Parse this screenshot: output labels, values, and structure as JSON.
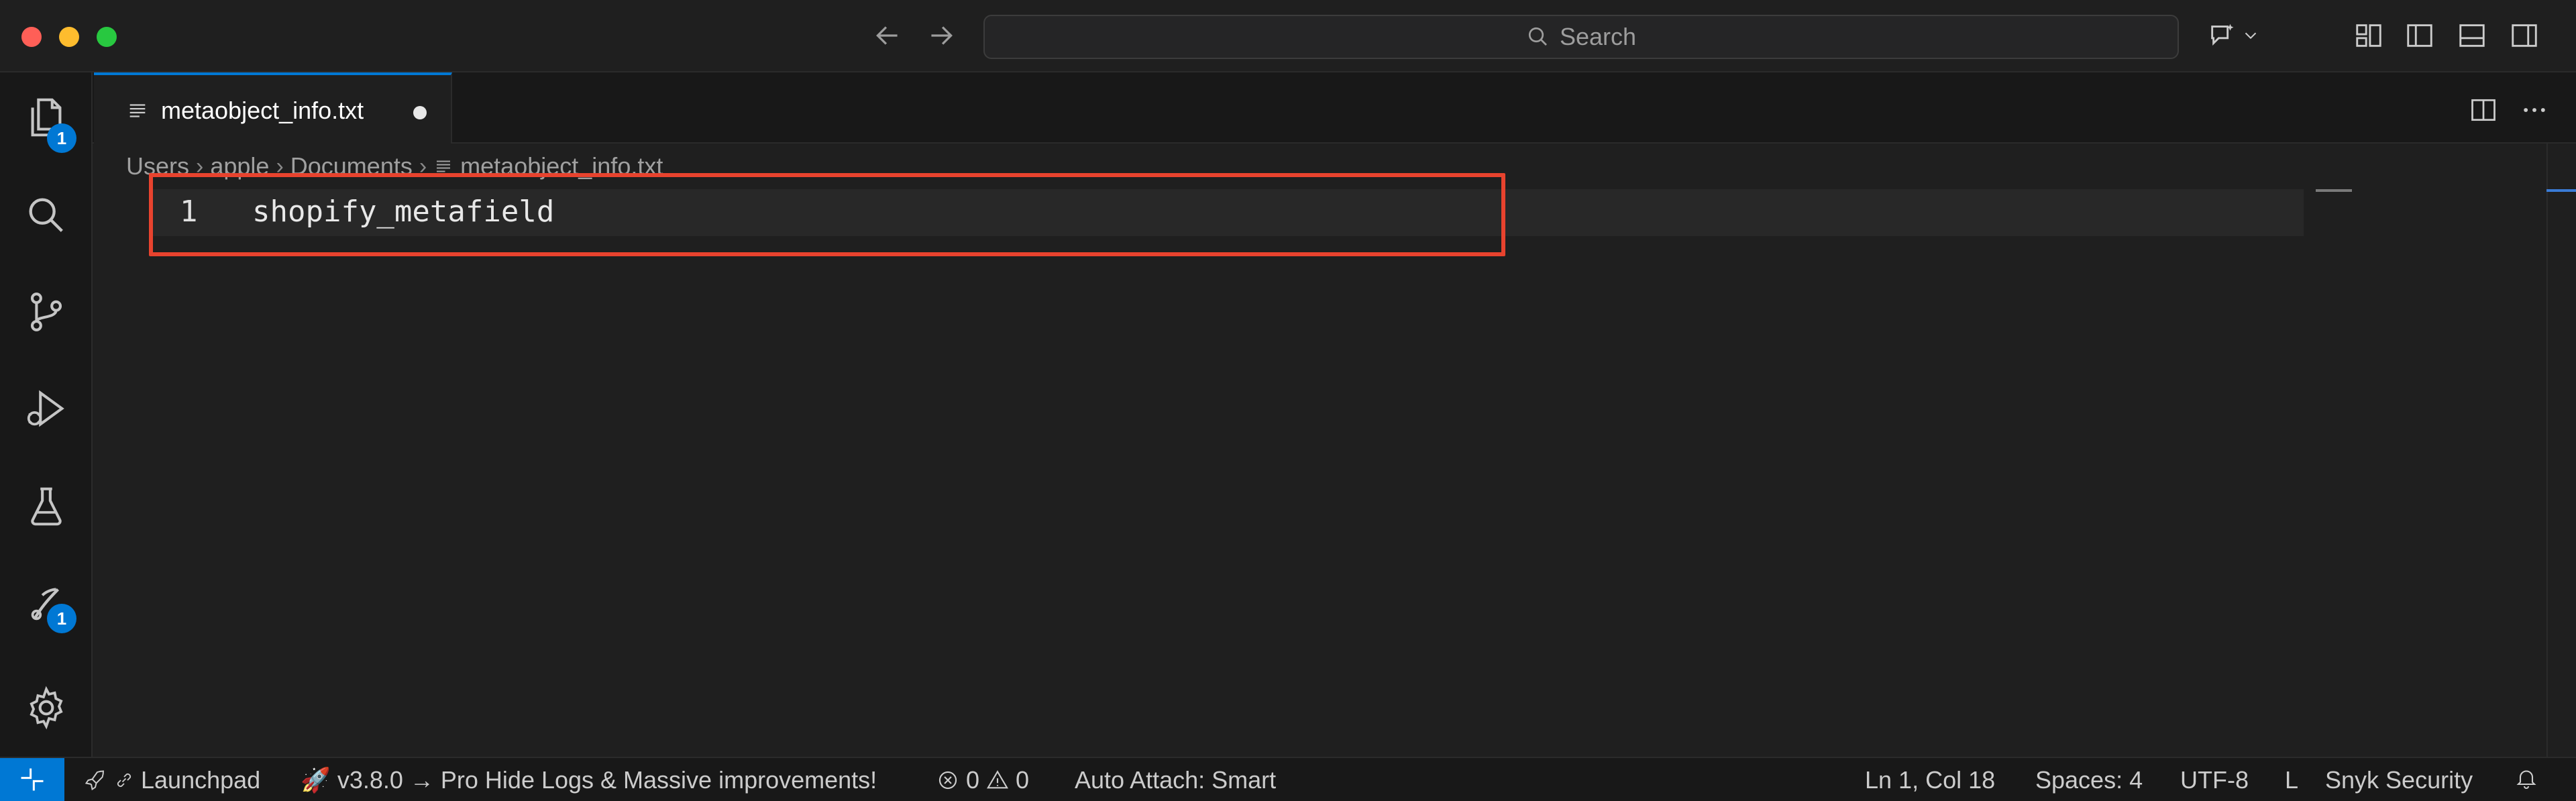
{
  "window": {
    "search_placeholder": "Search"
  },
  "tab": {
    "filename": "metaobject_info.txt",
    "modified": true
  },
  "breadcrumb": [
    "Users",
    "apple",
    "Documents",
    "metaobject_info.txt"
  ],
  "editor": {
    "lines": [
      {
        "number": "1",
        "text": "shopify_metafield"
      }
    ]
  },
  "activity_bar": {
    "explorer_badge": "1",
    "extension_badge": "1"
  },
  "status_bar": {
    "launchpad": "Launchpad",
    "version_message": "v3.8.0 → Pro Hide Logs & Massive improvements!",
    "errors": "0",
    "warnings": "0",
    "auto_attach": "Auto Attach: Smart",
    "cursor_position": "Ln 1, Col 18",
    "indentation": "Spaces: 4",
    "encoding": "UTF-8",
    "eol": "L",
    "snyk": "Snyk Security"
  },
  "colors": {
    "accent": "#0078d4",
    "highlight_box": "#e8432e",
    "close": "#ff5f57",
    "minimize": "#febc2e",
    "maximize": "#28c840"
  }
}
